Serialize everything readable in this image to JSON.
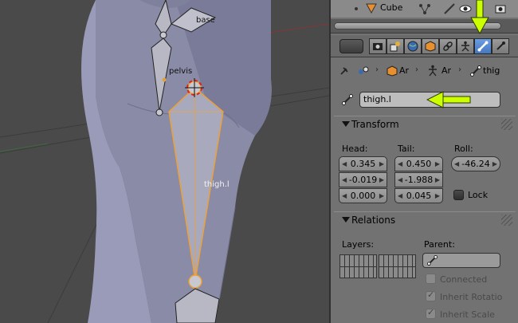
{
  "viewport": {
    "bone_labels": {
      "base": "base",
      "pelvis": "pelvis",
      "thigh": "thigh.l"
    }
  },
  "outliner": {
    "object_name": "Cube"
  },
  "context_tabs": [
    "render",
    "render-layers",
    "scene",
    "world",
    "object",
    "constraints",
    "object-data",
    "bone",
    "bone-constraints"
  ],
  "breadcrumb": {
    "item1": "Ar",
    "item2": "Ar",
    "item3": "thig"
  },
  "bone_name": "thigh.l",
  "transform": {
    "title": "Transform",
    "head_label": "Head:",
    "tail_label": "Tail:",
    "roll_label": "Roll:",
    "head": [
      "0.345",
      "-0.019",
      "0.000"
    ],
    "tail": [
      "0.450",
      "-1.988",
      "0.045"
    ],
    "roll": "-46.24",
    "lock_label": "Lock"
  },
  "relations": {
    "title": "Relations",
    "layers_label": "Layers:",
    "parent_label": "Parent:",
    "connected_label": "Connected",
    "inherit_rotation_label": "Inherit Rotatio",
    "inherit_scale_label": "Inherit Scale"
  },
  "colors": {
    "accent_active": "#4677c1",
    "bone_selected": "#f0a030",
    "highlight_arrow": "#ccff00"
  }
}
